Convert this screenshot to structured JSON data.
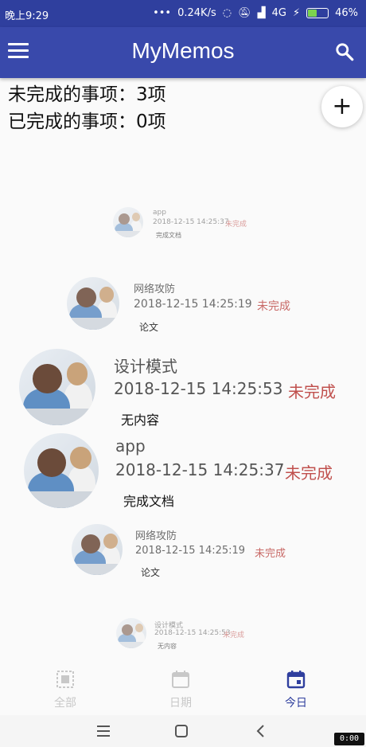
{
  "status_bar": {
    "time": "晚上9:29",
    "network_speed": "0.24K/s",
    "network_type": "4G",
    "battery": "46%",
    "battery_level": 0.46
  },
  "app_bar": {
    "title": "MyMemos",
    "menu_icon": "hamburger-menu-icon",
    "search_icon": "search-icon"
  },
  "summary": {
    "incomplete": "未完成的事项：3项",
    "complete": "已完成的事项：0项"
  },
  "fab": {
    "icon": "plus-icon",
    "label": "+"
  },
  "memos": [
    {
      "title": "app",
      "date": "2018-12-15 14:25:37",
      "status": "未完成",
      "content": "完成文档"
    },
    {
      "title": "网络攻防",
      "date": "2018-12-15 14:25:19",
      "status": "未完成",
      "content": "论文"
    },
    {
      "title": "设计模式",
      "date": "2018-12-15 14:25:53",
      "status": "未完成",
      "content": "无内容"
    },
    {
      "title": "app",
      "date": "2018-12-15 14:25:37",
      "status": "未完成",
      "content": "完成文档"
    },
    {
      "title": "网络攻防",
      "date": "2018-12-15 14:25:19",
      "status": "未完成",
      "content": "论文"
    },
    {
      "title": "设计模式",
      "date": "2018-12-15 14:25:53",
      "status": "未完成",
      "content": "无内容"
    }
  ],
  "bottom_nav": {
    "items": [
      {
        "label": "全部",
        "icon": "all-icon",
        "active": false
      },
      {
        "label": "日期",
        "icon": "calendar-icon",
        "active": false
      },
      {
        "label": "今日",
        "icon": "today-calendar-icon",
        "active": true
      }
    ]
  },
  "system_nav": {
    "recents_icon": "recents-icon",
    "home_icon": "home-icon",
    "back_icon": "back-icon"
  },
  "recording_badge": "0:00",
  "colors": {
    "primary": "#3949ab",
    "status_bar": "#2f3f9e",
    "status_text": "#c0504d",
    "inactive_nav": "#c8c8c8"
  }
}
